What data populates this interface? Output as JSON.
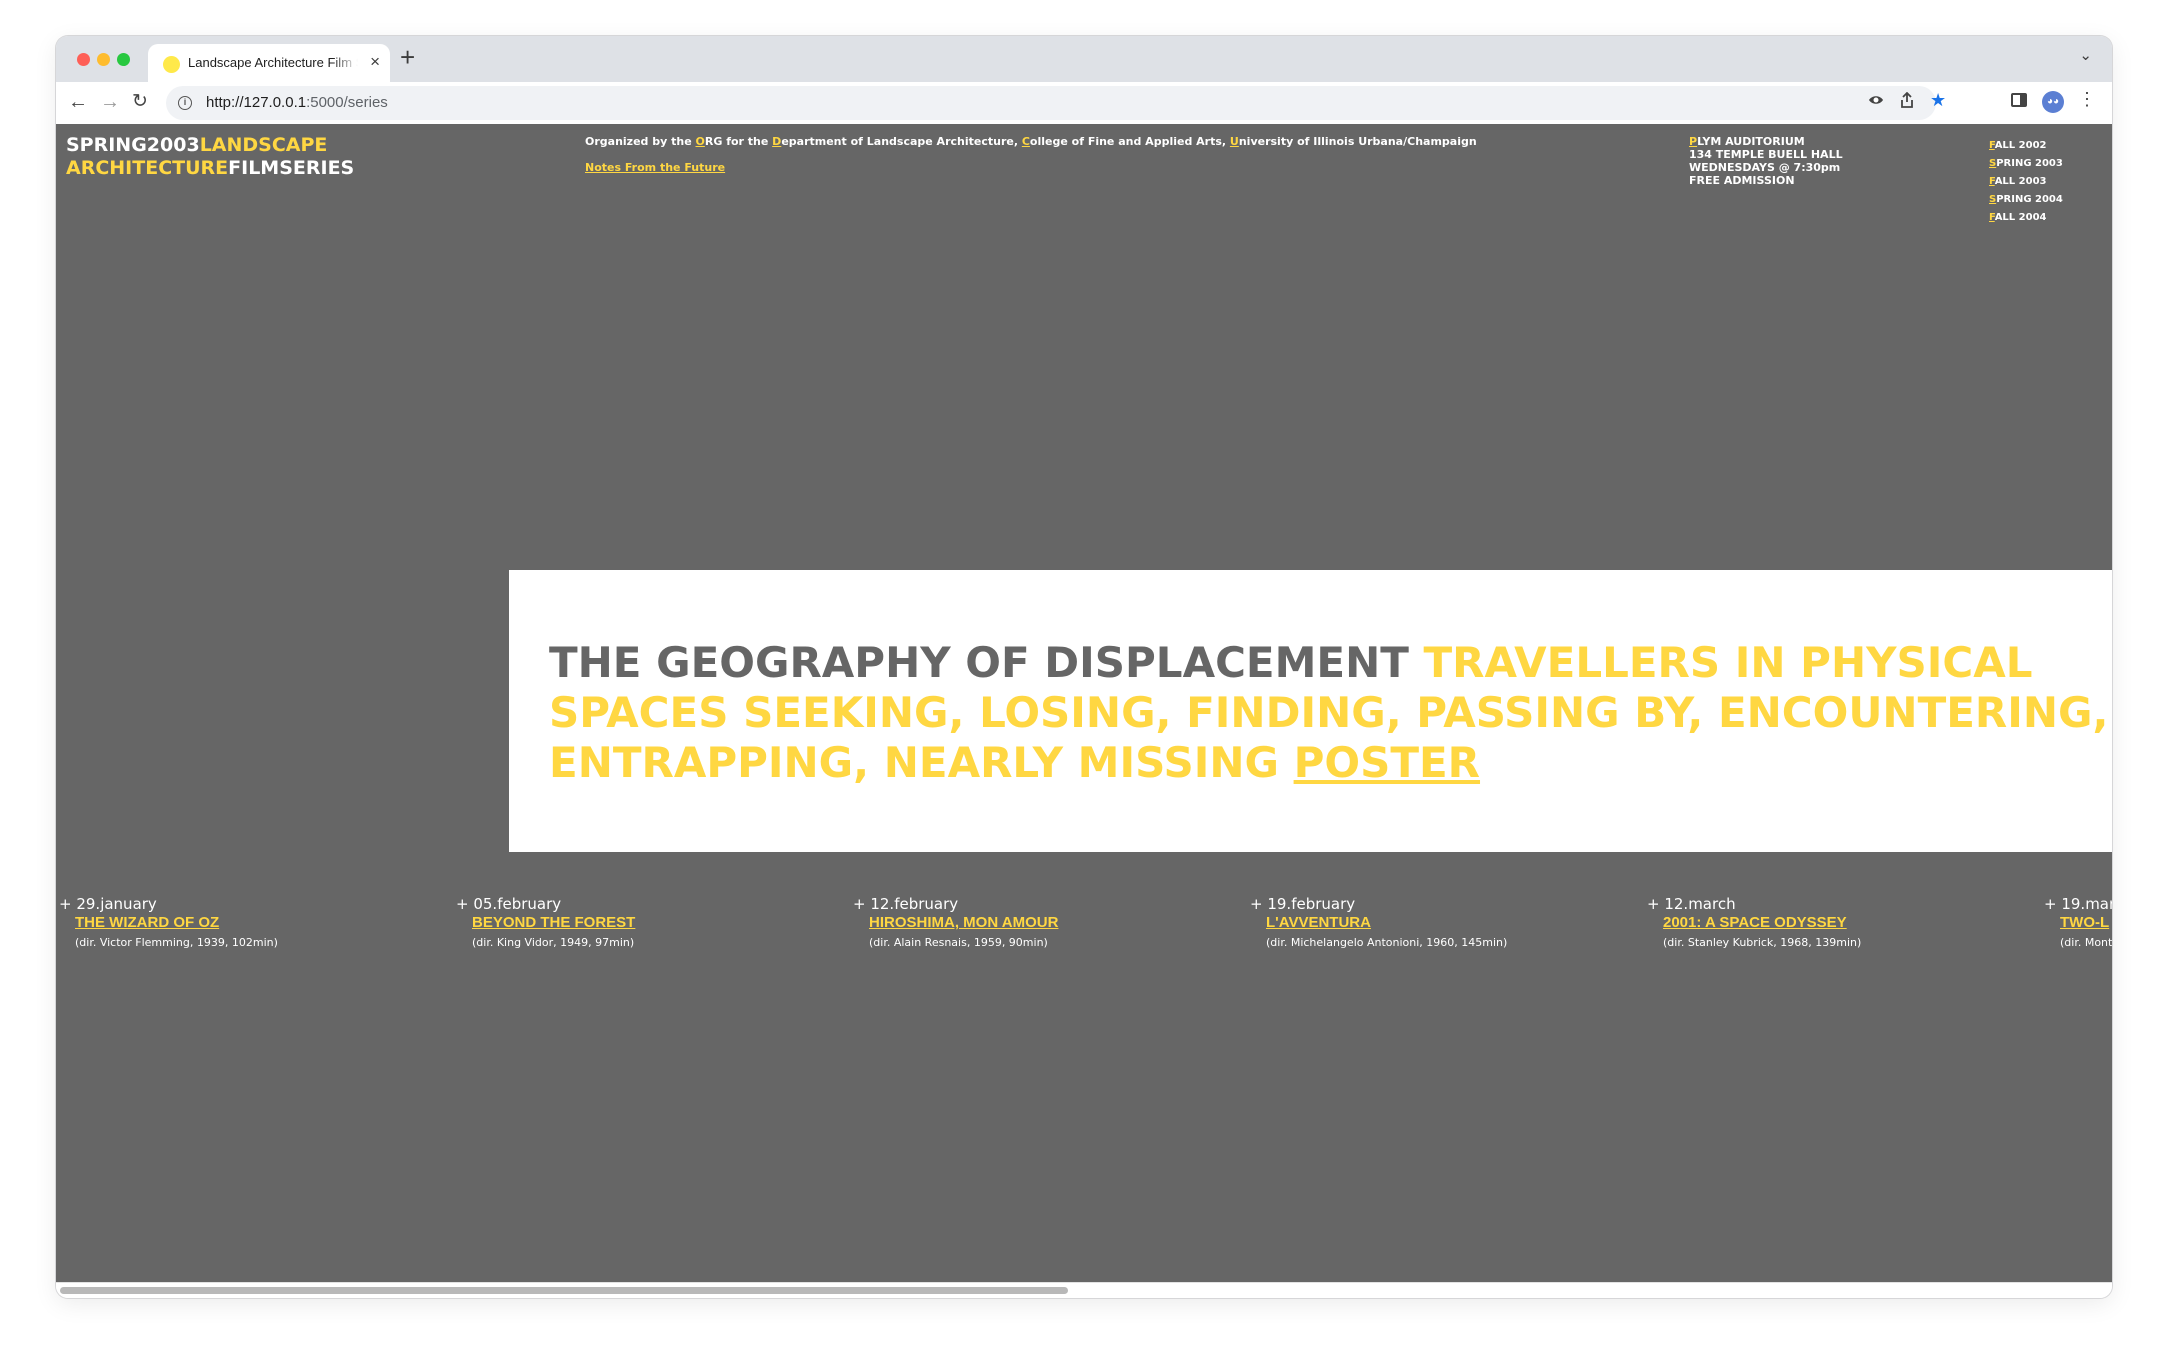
{
  "browser": {
    "tab_title": "Landscape Architecture Film Series",
    "tab_close": "×",
    "new_tab": "+",
    "tab_list": "⌄",
    "back": "←",
    "forward": "→",
    "reload": "↻",
    "url_host": "http://127.0.0.1",
    "url_rest": ":5000/series",
    "info_glyph": "i",
    "icons": [
      "eye-icon",
      "share-icon",
      "star-icon",
      "sidepanel-icon",
      "avatar",
      "menu-icon"
    ],
    "star_color": "#1a73e8"
  },
  "site": {
    "title_parts": [
      "SPRING2003",
      "LANDSCAPE",
      "ARCHITECTURE",
      "FILMSERIES"
    ],
    "org": {
      "p1": "Organized by the ",
      "o": "O",
      "p2": "RG for the ",
      "d": "D",
      "p3": "epartment of Landscape Architecture, ",
      "c": "C",
      "p4": "ollege of Fine and Applied Arts, ",
      "u": "U",
      "p5": "niversity of Illinois Urbana/Champaign"
    },
    "notes_link": "Notes From the Future",
    "venue": {
      "first_letter": "P",
      "line1_rest": "LYM AUDITORIUM",
      "line2": "134 TEMPLE BUELL HALL",
      "line3": "WEDNESDAYS @ 7:30pm",
      "line4": "FREE ADMISSION"
    },
    "semesters": [
      {
        "initial": "F",
        "rest": "ALL 2002"
      },
      {
        "initial": "S",
        "rest": "PRING 2003"
      },
      {
        "initial": "F",
        "rest": "ALL 2003"
      },
      {
        "initial": "S",
        "rest": "PRING 2004"
      },
      {
        "initial": "F",
        "rest": "ALL 2004"
      }
    ],
    "hero": {
      "dark": "THE GEOGRAPHY OF DISPLACEMENT",
      "yellow": "TRAVELLERS IN PHYSICAL SPACES SEEKING, LOSING, FINDING, PASSING BY, ENCOUNTERING, ENTRAPPING, NEARLY MISSING",
      "link": "POSTER"
    },
    "films": [
      {
        "date": "+ 29.january",
        "title": "THE WIZARD OF OZ",
        "dir": "(dir. Victor Flemming, 1939, 102min)"
      },
      {
        "date": "+ 05.february",
        "title": "BEYOND THE FOREST",
        "dir": "(dir. King Vidor, 1949, 97min)"
      },
      {
        "date": "+ 12.february",
        "title": "HIROSHIMA, MON AMOUR",
        "dir": "(dir. Alain Resnais, 1959, 90min)"
      },
      {
        "date": "+ 19.february",
        "title": "L'AVVENTURA",
        "dir": "(dir. Michelangelo Antonioni, 1960, 145min)"
      },
      {
        "date": "+ 12.march",
        "title": "2001: A SPACE ODYSSEY",
        "dir": "(dir. Stanley Kubrick, 1968, 139min)"
      },
      {
        "date": "+ 19.mar",
        "title": "TWO-L",
        "dir": "(dir. Mont"
      }
    ],
    "colors": {
      "background": "#666666",
      "accent": "#ffd742",
      "text": "#ffffff",
      "hero_bg": "#ffffff"
    }
  }
}
